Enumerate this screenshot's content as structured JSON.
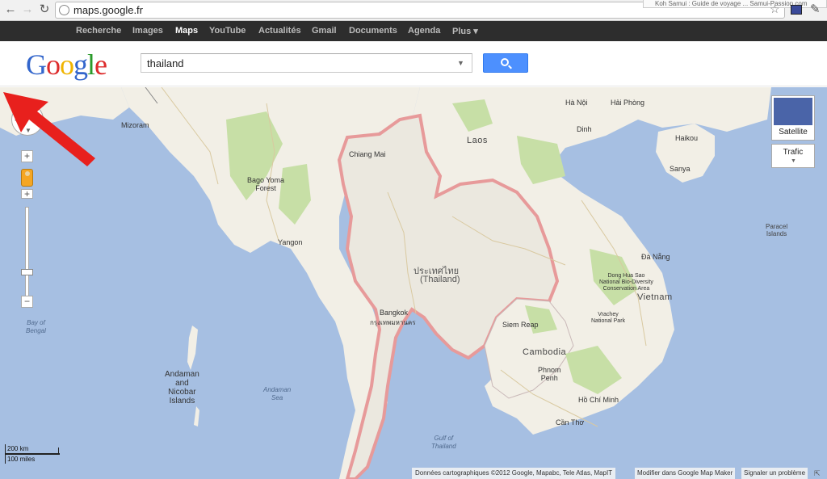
{
  "browser": {
    "url": "maps.google.fr",
    "tab_tooltip": "Koh Samui : Guide de voyage ... Samui-Passion.com"
  },
  "gbar": {
    "items": [
      "Recherche",
      "Images",
      "Maps",
      "YouTube",
      "Actualités",
      "Gmail",
      "Documents",
      "Agenda",
      "Plus ▾"
    ],
    "active": "Maps"
  },
  "header": {
    "logo_letters": [
      "G",
      "o",
      "o",
      "g",
      "l",
      "e"
    ],
    "search_value": "thailand"
  },
  "map": {
    "countries": {
      "laos": "Laos",
      "thailand_native": "ประเทศไทย",
      "thailand": "(Thailand)",
      "cambodia": "Cambodia",
      "vietnam": "Vietnam"
    },
    "water": {
      "bay_of_bengal": [
        "Bay of",
        "Bengal"
      ],
      "andaman_sea": [
        "Andaman",
        "Sea"
      ],
      "gulf_of_thailand": [
        "Gulf of",
        "Thailand"
      ]
    },
    "islands": {
      "andaman_nicobar": [
        "Andaman",
        "and",
        "Nicobar",
        "Islands"
      ],
      "paracel": [
        "Paracel",
        "Islands"
      ]
    },
    "regions": {
      "mizoram": "Mizoram",
      "bago_yoma": [
        "Bago Yoma",
        "Forest"
      ]
    },
    "cities": {
      "yangon": "Yangon",
      "bangkok": "Bangkok",
      "bangkok_native": "กรุงเทพมหานคร",
      "phnom_penh": [
        "Phnom",
        "Penh"
      ],
      "ho_chi_minh": "Hồ Chí Minh",
      "can_tho": "Cần Thơ",
      "ha_noi": "Hà Nội",
      "hai_phong": "Hải Phòng",
      "da_nang": "Đà Nẵng",
      "haikou": "Haikou",
      "sanya": "Sanya",
      "dinh": "Dinh",
      "siem_reap": "Siem Reap",
      "chiang_mai": "Chiang Mai"
    },
    "parks": {
      "dong_hua_sao": [
        "Dong Hua Sao",
        "National Bio-Diversity",
        "Conservation Area"
      ],
      "yok_don": [
        "Vrachey",
        "National Park"
      ]
    },
    "controls": {
      "satellite": "Satellite",
      "traffic": "Trafic",
      "zoom_in": "+",
      "zoom_out": "−"
    },
    "scale": {
      "km": "200 km",
      "miles": "100 miles"
    },
    "attribution": "Données cartographiques ©2012 Google, Mapabc, Tele Atlas, MapIT",
    "report_link": "Modifier dans Google Map Maker",
    "problem_link": "Signaler un problème"
  },
  "colors": {
    "water": "#a6bfe2",
    "land": "#f2efe6",
    "forest": "#c7dfa6",
    "border_highlight": "#e79a9a",
    "arrow": "#e8201d",
    "search_button": "#4d90fe"
  }
}
